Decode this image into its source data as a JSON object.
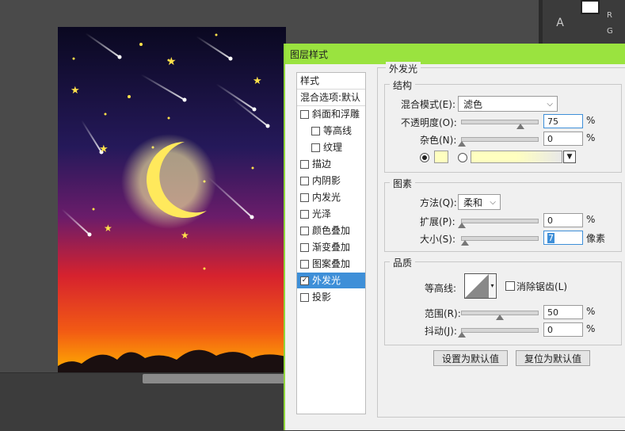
{
  "workspace": {
    "text_tool_label": "A",
    "panel_letters": [
      "R",
      "G"
    ]
  },
  "dialog": {
    "title": "图层样式",
    "style_list": [
      {
        "label": "样式",
        "checkbox": false,
        "indent": 0,
        "selected": false,
        "header": true
      },
      {
        "label": "混合选项:默认",
        "checkbox": false,
        "indent": 0,
        "selected": false,
        "header": true
      },
      {
        "label": "斜面和浮雕",
        "checkbox": true,
        "checked": false,
        "indent": 0,
        "selected": false
      },
      {
        "label": "等高线",
        "checkbox": true,
        "checked": false,
        "indent": 1,
        "selected": false
      },
      {
        "label": "纹理",
        "checkbox": true,
        "checked": false,
        "indent": 1,
        "selected": false
      },
      {
        "label": "描边",
        "checkbox": true,
        "checked": false,
        "indent": 0,
        "selected": false
      },
      {
        "label": "内阴影",
        "checkbox": true,
        "checked": false,
        "indent": 0,
        "selected": false
      },
      {
        "label": "内发光",
        "checkbox": true,
        "checked": false,
        "indent": 0,
        "selected": false
      },
      {
        "label": "光泽",
        "checkbox": true,
        "checked": false,
        "indent": 0,
        "selected": false
      },
      {
        "label": "颜色叠加",
        "checkbox": true,
        "checked": false,
        "indent": 0,
        "selected": false
      },
      {
        "label": "渐变叠加",
        "checkbox": true,
        "checked": false,
        "indent": 0,
        "selected": false
      },
      {
        "label": "图案叠加",
        "checkbox": true,
        "checked": false,
        "indent": 0,
        "selected": false
      },
      {
        "label": "外发光",
        "checkbox": true,
        "checked": true,
        "indent": 0,
        "selected": true
      },
      {
        "label": "投影",
        "checkbox": true,
        "checked": false,
        "indent": 0,
        "selected": false
      }
    ],
    "outer_glow": {
      "section_title": "外发光",
      "structure": {
        "group_title": "结构",
        "blend_mode_label": "混合模式(E):",
        "blend_mode_value": "滤色",
        "opacity_label": "不透明度(O):",
        "opacity_value": "75",
        "opacity_unit": "%",
        "noise_label": "杂色(N):",
        "noise_value": "0",
        "noise_unit": "%",
        "glow_color": "#ffffc0",
        "fill_mode": "color"
      },
      "elements": {
        "group_title": "图素",
        "technique_label": "方法(Q):",
        "technique_value": "柔和",
        "spread_label": "扩展(P):",
        "spread_value": "0",
        "spread_unit": "%",
        "size_label": "大小(S):",
        "size_value": "7",
        "size_unit": "像素"
      },
      "quality": {
        "group_title": "品质",
        "contour_label": "等高线:",
        "antialias_label": "消除锯齿(L)",
        "antialias_checked": false,
        "range_label": "范围(R):",
        "range_value": "50",
        "range_unit": "%",
        "jitter_label": "抖动(J):",
        "jitter_value": "0",
        "jitter_unit": "%"
      },
      "buttons": {
        "make_default": "设置为默认值",
        "reset_default": "复位为默认值"
      }
    }
  },
  "colors": {
    "title_bar": "#9ae33f",
    "selection": "#3e8fd8"
  }
}
